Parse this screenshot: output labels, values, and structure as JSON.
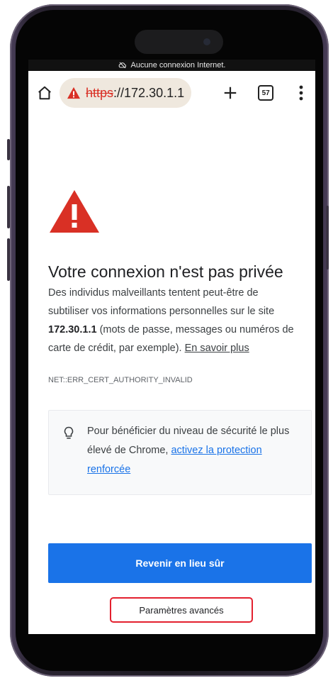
{
  "status_bar": {
    "text": "Aucune connexion Internet.",
    "icon": "cloud-off-icon"
  },
  "toolbar": {
    "home_icon": "home-icon",
    "url_scheme": "https",
    "url_rest": "://172.30.1.1",
    "security_icon": "warning-icon",
    "new_tab_icon": "plus-icon",
    "tab_count": "57",
    "menu_icon": "kebab-menu-icon"
  },
  "page": {
    "title": "Votre connexion n'est pas privée",
    "desc_1": "Des individus malveillants tentent peut-être de subtiliser vos informations personnelles sur le site ",
    "desc_host": "172.30.1.1",
    "desc_2": " (mots de passe, messages ou numéros de carte de crédit, par exemple). ",
    "learn_more": "En savoir plus",
    "error_code": "NET::ERR_CERT_AUTHORITY_INVALID",
    "info_text": "Pour bénéficier du niveau de sécurité le plus élevé de Chrome, ",
    "info_link": "activez la protection renforcée",
    "primary_button": "Revenir en lieu sûr",
    "advanced_button": "Paramètres avancés"
  },
  "colors": {
    "accent": "#1a73e8",
    "danger": "#d93025",
    "highlight_box": "#e3202e"
  }
}
